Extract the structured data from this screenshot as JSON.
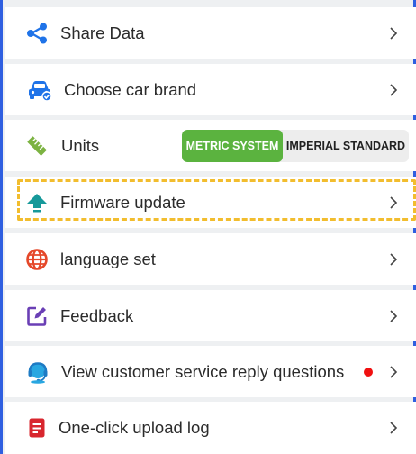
{
  "menu": {
    "share_data": {
      "label": "Share Data",
      "icon": "share-icon"
    },
    "choose_car_brand": {
      "label": "Choose car brand",
      "icon": "car-icon"
    },
    "units": {
      "label": "Units",
      "icon": "ruler-icon",
      "options": [
        "METRIC SYSTEM",
        "IMPERIAL STANDARD"
      ],
      "selected": "METRIC SYSTEM"
    },
    "firmware_update": {
      "label": "Firmware update",
      "icon": "upload-arrow-icon"
    },
    "language_set": {
      "label": "language set",
      "icon": "globe-icon"
    },
    "feedback": {
      "label": "Feedback",
      "icon": "edit-icon"
    },
    "customer_service": {
      "label": "View customer service reply questions",
      "icon": "headset-icon",
      "has_unread": true
    },
    "upload_log": {
      "label": "One-click upload log",
      "icon": "document-icon"
    }
  },
  "colors": {
    "accent_blue": "#2f5fe0",
    "toggle_on": "#5bb33f",
    "highlight": "#f2bd2e",
    "unread_dot": "#f01010"
  }
}
